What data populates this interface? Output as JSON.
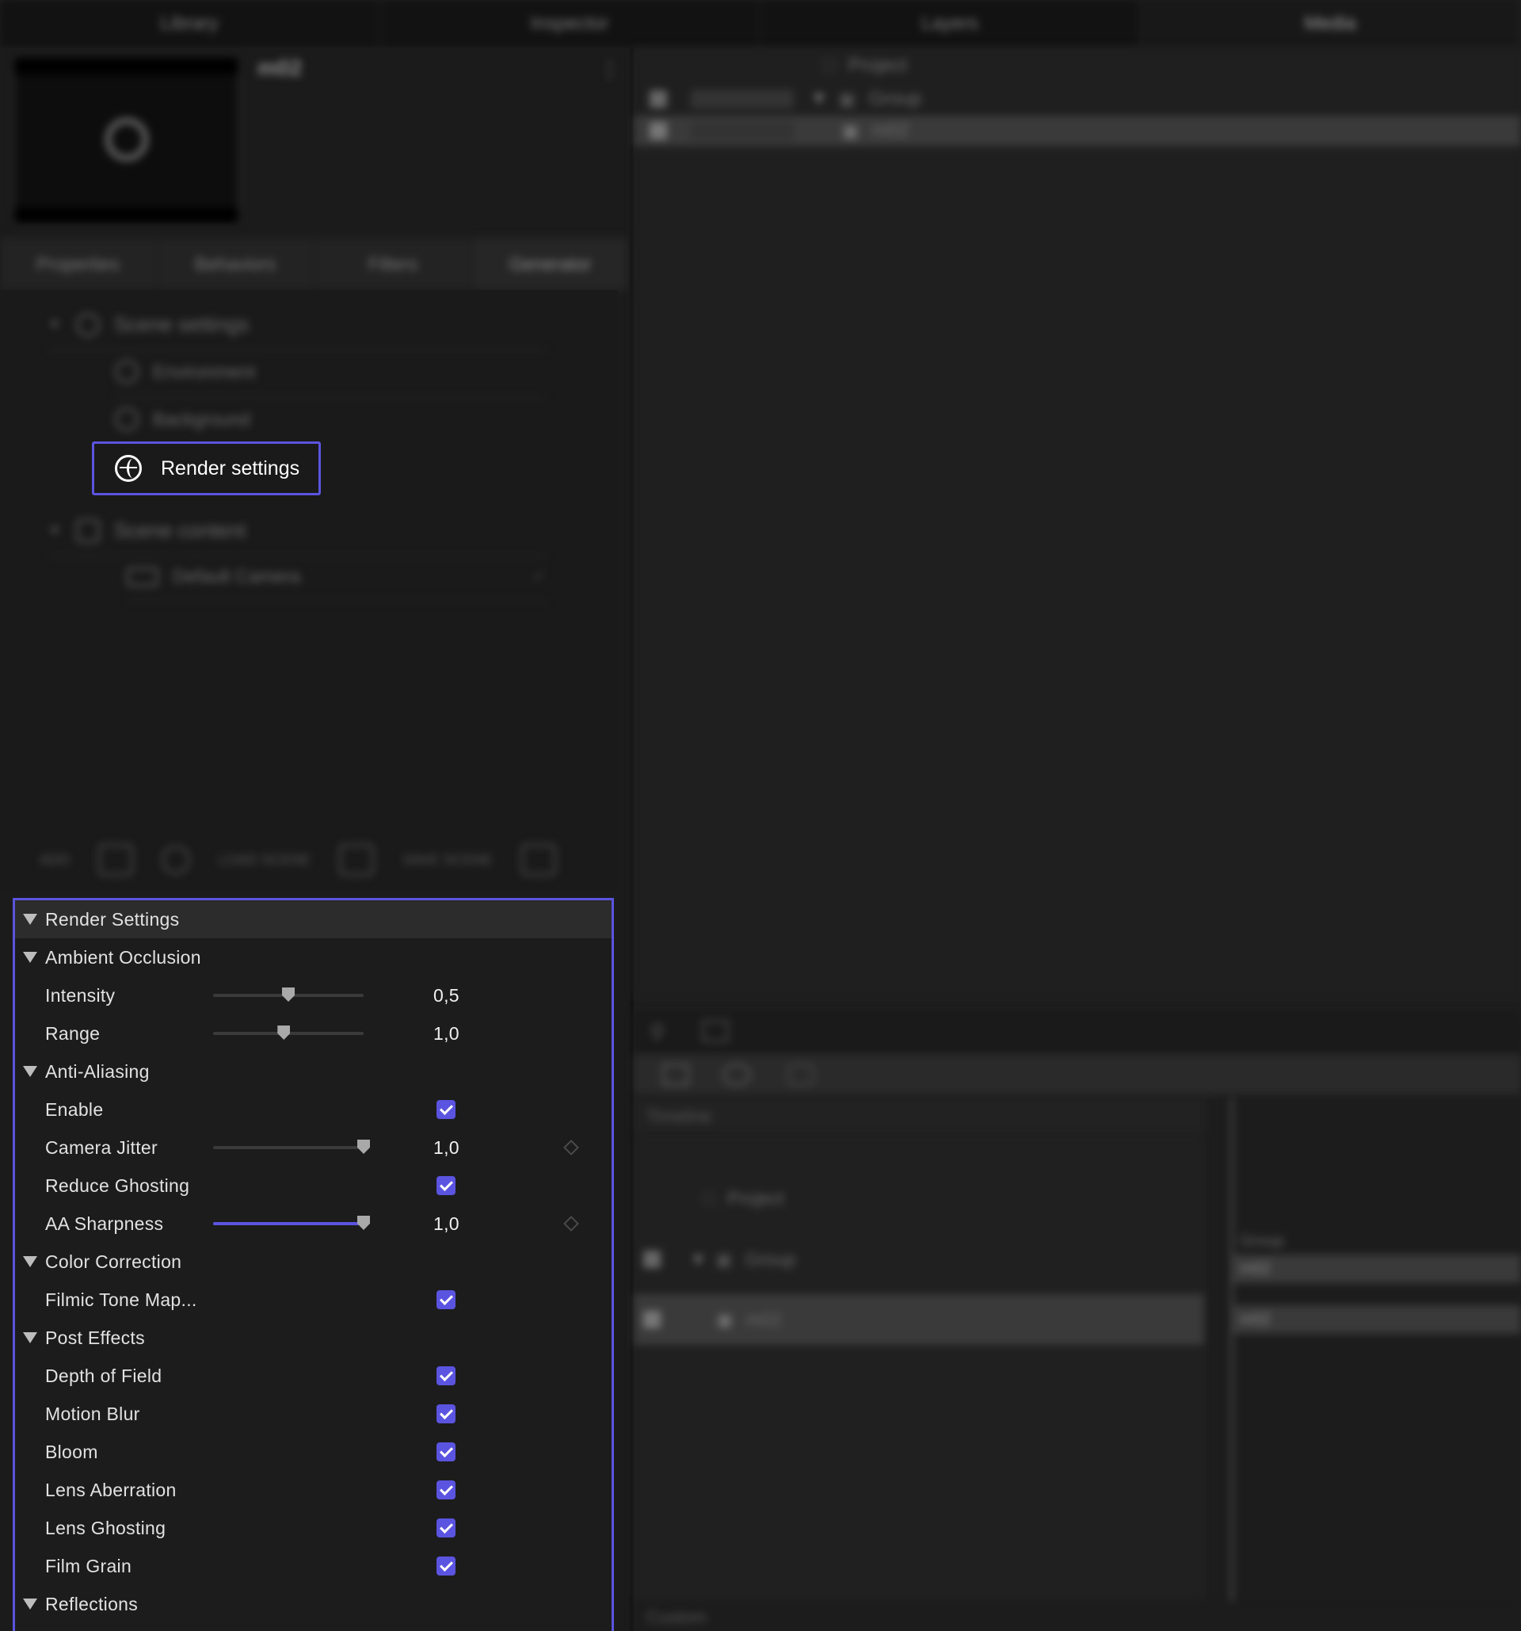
{
  "top_tabs": [
    "Library",
    "Inspector",
    "Layers",
    "Media"
  ],
  "asset": {
    "name": "m02"
  },
  "sub_tabs": [
    "Properties",
    "Behaviors",
    "Filters",
    "Generator"
  ],
  "scene_tree": {
    "scene_settings": "Scene settings",
    "environment": "Environment",
    "background": "Background",
    "render_settings": "Render settings",
    "scene_content": "Scene content",
    "default_camera": "Default Camera"
  },
  "scene_toolbar": {
    "add": "ADD",
    "load": "LOAD SCENE",
    "save": "SAVE SCENE"
  },
  "render_panel": {
    "title": "Render Settings",
    "sections": {
      "ambient_occlusion": "Ambient Occlusion",
      "anti_aliasing": "Anti-Aliasing",
      "color_correction": "Color Correction",
      "post_effects": "Post Effects",
      "reflections": "Reflections"
    },
    "intensity": {
      "label": "Intensity",
      "value": "0,5",
      "slider_fraction": 0.5
    },
    "range": {
      "label": "Range",
      "value": "1,0",
      "slider_fraction": 0.47
    },
    "enable": {
      "label": "Enable",
      "checked": true
    },
    "camera_jitter": {
      "label": "Camera Jitter",
      "value": "1,0",
      "slider_fraction": 1.0
    },
    "reduce_ghosting": {
      "label": "Reduce Ghosting",
      "checked": true
    },
    "aa_sharpness": {
      "label": "AA Sharpness",
      "value": "1,0",
      "slider_fraction": 1.0
    },
    "filmic_tone_map": {
      "label": "Filmic Tone Map...",
      "checked": true
    },
    "depth_of_field": {
      "label": "Depth of Field",
      "checked": true
    },
    "motion_blur": {
      "label": "Motion Blur",
      "checked": true
    },
    "bloom": {
      "label": "Bloom",
      "checked": true
    },
    "lens_aberration": {
      "label": "Lens Aberration",
      "checked": true
    },
    "lens_ghosting": {
      "label": "Lens Ghosting",
      "checked": true
    },
    "film_grain": {
      "label": "Film Grain",
      "checked": true
    }
  },
  "layers": {
    "project": "Project",
    "group": "Group",
    "item": "m02"
  },
  "timeline": {
    "label": "Timeline",
    "project": "Project",
    "group": "Group",
    "item": "m02",
    "clip_group": "Group",
    "clip_item": "m02",
    "footer": "Custom"
  },
  "colors": {
    "accent": "#5b54e0",
    "bg": "#1e1e1e"
  }
}
